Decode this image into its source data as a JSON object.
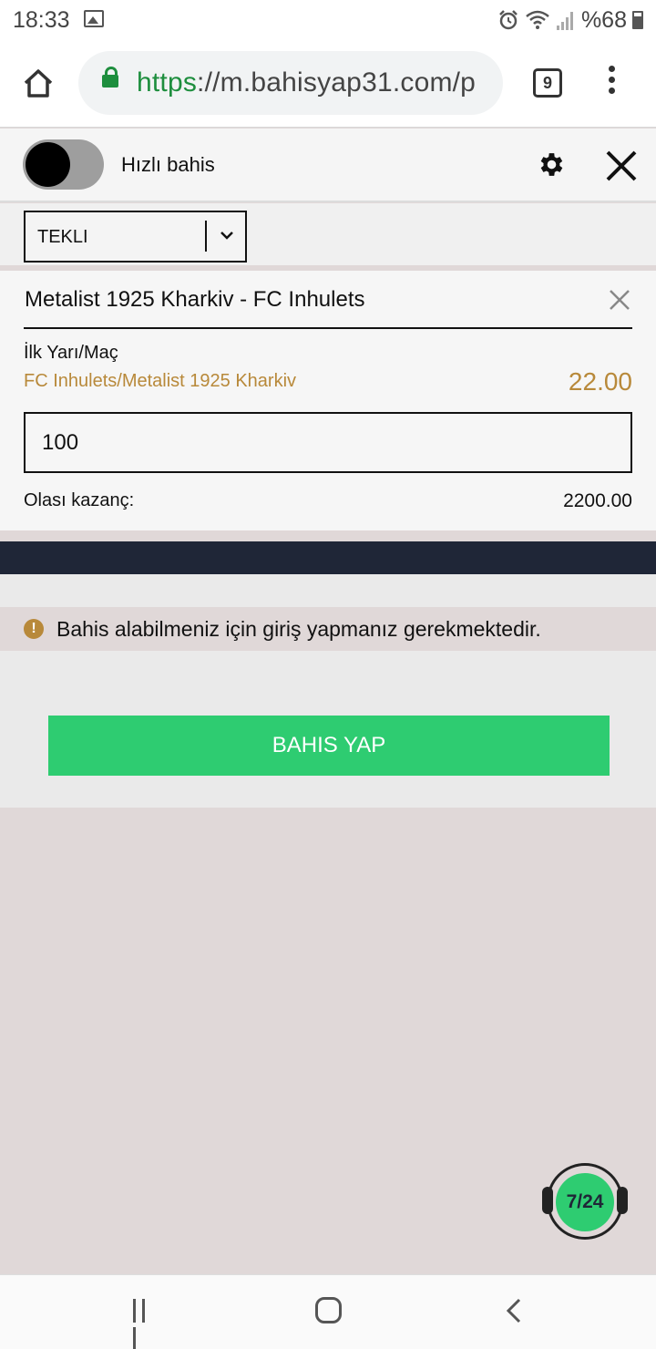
{
  "status_bar": {
    "time": "18:33",
    "battery": "%68"
  },
  "browser": {
    "url_scheme": "https",
    "url_rest": "://m.bahisyap31.com/p",
    "tab_count": "9"
  },
  "quick_bet": {
    "label": "Hızlı bahis",
    "enabled": false
  },
  "bet_type": {
    "selected": "TEKLI"
  },
  "bet": {
    "match": "Metalist 1925 Kharkiv - FC Inhulets",
    "market": "İlk Yarı/Maç",
    "selection": "FC Inhulets/Metalist 1925 Kharkiv",
    "odds": "22.00",
    "stake": "100",
    "potential_win_label": "Olası kazanç:",
    "potential_win_value": "2200.00"
  },
  "warning": {
    "text": "Bahis alabilmeniz için giriş yapmanız gerekmektedir.",
    "icon": "!"
  },
  "actions": {
    "place_bet_label": "BAHIS YAP"
  },
  "chat": {
    "label": "7/24"
  },
  "colors": {
    "accent_green": "#2ecc71",
    "odds_gold": "#b8893a",
    "dark_band": "#1f2637"
  }
}
